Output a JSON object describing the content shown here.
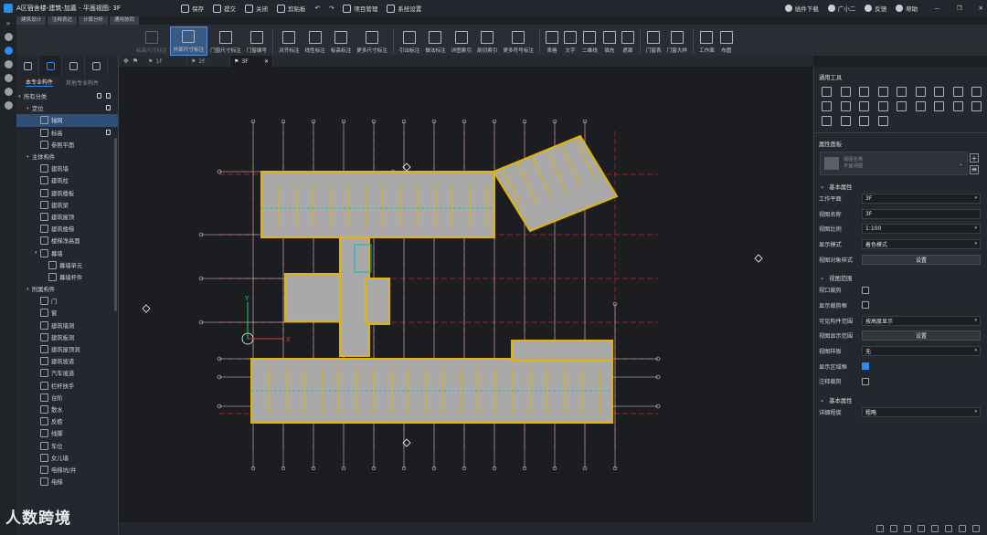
{
  "titlebar": {
    "title": "A区宿舍楼-建筑-加嘉 - 平面视图: 3F",
    "quick": [
      "保存",
      "提交",
      "关闭",
      "剪贴板",
      "项目管理",
      "系统设置"
    ],
    "right": [
      "插件下载",
      "广小二",
      "反馈",
      "帮助"
    ]
  },
  "app_tabs": [
    "建筑设计",
    "注释表达",
    "计算分析",
    "通用协同"
  ],
  "ribbon": [
    {
      "label": "标高尺寸标注",
      "state": "disabled"
    },
    {
      "label": "外部尺寸标注",
      "state": "selected"
    },
    {
      "label": "门窗尺寸标注",
      "state": "normal"
    },
    {
      "label": "门窗编号",
      "state": "normal"
    },
    {
      "label": "对齐标注",
      "state": "normal"
    },
    {
      "label": "线性标注",
      "state": "normal"
    },
    {
      "label": "标高标注",
      "state": "normal"
    },
    {
      "label": "更多尺寸标注",
      "state": "normal"
    },
    {
      "label": "引出标注",
      "state": "normal"
    },
    {
      "label": "做法标注",
      "state": "normal"
    },
    {
      "label": "详图索引",
      "state": "normal"
    },
    {
      "label": "剖切索引",
      "state": "normal"
    },
    {
      "label": "更多符号标注",
      "state": "normal"
    },
    {
      "label": "表格",
      "state": "normal"
    },
    {
      "label": "文字",
      "state": "normal"
    },
    {
      "label": "二维线",
      "state": "normal"
    },
    {
      "label": "填充",
      "state": "normal"
    },
    {
      "label": "遮罩",
      "state": "normal"
    },
    {
      "label": "门窗表",
      "state": "normal"
    },
    {
      "label": "门窗大样",
      "state": "normal"
    },
    {
      "label": "工作面",
      "state": "normal"
    },
    {
      "label": "布图",
      "state": "normal"
    }
  ],
  "panel": {
    "tabs": [
      "本专业构件",
      "其他专业构件"
    ],
    "tree": [
      {
        "label": "所有分类",
        "level": 0,
        "caret": "▾",
        "lock": true,
        "eye": true
      },
      {
        "label": "定位",
        "level": 1,
        "caret": "▾",
        "lock": true
      },
      {
        "label": "轴网",
        "level": 2,
        "selected": true
      },
      {
        "label": "标高",
        "level": 2,
        "lock": true
      },
      {
        "label": "参照平面",
        "level": 2
      },
      {
        "label": "主体构件",
        "level": 1,
        "caret": "▾"
      },
      {
        "label": "建筑墙",
        "level": 2
      },
      {
        "label": "建筑柱",
        "level": 2
      },
      {
        "label": "建筑楼板",
        "level": 2
      },
      {
        "label": "建筑梁",
        "level": 2
      },
      {
        "label": "建筑屋顶",
        "level": 2
      },
      {
        "label": "建筑楼梯",
        "level": 2
      },
      {
        "label": "楼梯净高面",
        "level": 2
      },
      {
        "label": "幕墙",
        "level": 2,
        "caret": "▾"
      },
      {
        "label": "幕墙单元",
        "level": 3
      },
      {
        "label": "幕墙杆件",
        "level": 3
      },
      {
        "label": "附属构件",
        "level": 1,
        "caret": "▾"
      },
      {
        "label": "门",
        "level": 2
      },
      {
        "label": "窗",
        "level": 2
      },
      {
        "label": "建筑墙洞",
        "level": 2
      },
      {
        "label": "建筑板洞",
        "level": 2
      },
      {
        "label": "建筑屋顶洞",
        "level": 2
      },
      {
        "label": "建筑坡道",
        "level": 2
      },
      {
        "label": "汽车坡道",
        "level": 2
      },
      {
        "label": "栏杆扶手",
        "level": 2
      },
      {
        "label": "台阶",
        "level": 2
      },
      {
        "label": "散水",
        "level": 2
      },
      {
        "label": "反檐",
        "level": 2
      },
      {
        "label": "线脚",
        "level": 2
      },
      {
        "label": "车位",
        "level": 2
      },
      {
        "label": "女儿墙",
        "level": 2
      },
      {
        "label": "电梯坑/井",
        "level": 2
      },
      {
        "label": "电梯",
        "level": 2
      }
    ]
  },
  "view_tabs": [
    {
      "label": "1F",
      "active": false
    },
    {
      "label": "2F",
      "active": false
    },
    {
      "label": "3F",
      "active": true
    }
  ],
  "canvas": {
    "axis_x": "X",
    "axis_y": "Y",
    "colors": {
      "wall": "#e3b400",
      "room": "#a9a9a9",
      "grid": "#c62828",
      "dim": "#d9d9d9",
      "door": "#00bcd4"
    }
  },
  "right_panel": {
    "tools_title": "通用工具",
    "prop_title": "属性面板",
    "preview": {
      "line1": "视图名称",
      "line2": "平面视图"
    },
    "groups": [
      {
        "title": "基本属性",
        "rows": [
          {
            "label": "工作平面",
            "type": "select",
            "value": "3F"
          },
          {
            "label": "视图名称",
            "type": "text",
            "value": "3F"
          },
          {
            "label": "视图比例",
            "type": "select",
            "value": "1:100"
          },
          {
            "label": "显示模式",
            "type": "select",
            "value": "着色模式"
          },
          {
            "label": "视图对象样式",
            "type": "button",
            "value": "设置"
          }
        ]
      },
      {
        "title": "视图范围",
        "rows": [
          {
            "label": "视口裁剪",
            "type": "check",
            "value": false
          },
          {
            "label": "显示裁剪框",
            "type": "check",
            "value": false
          },
          {
            "label": "可见构件范围",
            "type": "select",
            "value": "按高度显示"
          },
          {
            "label": "视图显示范围",
            "type": "button",
            "value": "设置"
          },
          {
            "label": "视图样板",
            "type": "select",
            "value": "无"
          },
          {
            "label": "显示区域框",
            "type": "check",
            "value": true
          },
          {
            "label": "注释裁剪",
            "type": "check",
            "value": false
          }
        ]
      },
      {
        "title": "基本属性",
        "rows": [
          {
            "label": "详细程度",
            "type": "select",
            "value": "粗略"
          }
        ]
      }
    ]
  },
  "watermark": "人数跨境"
}
